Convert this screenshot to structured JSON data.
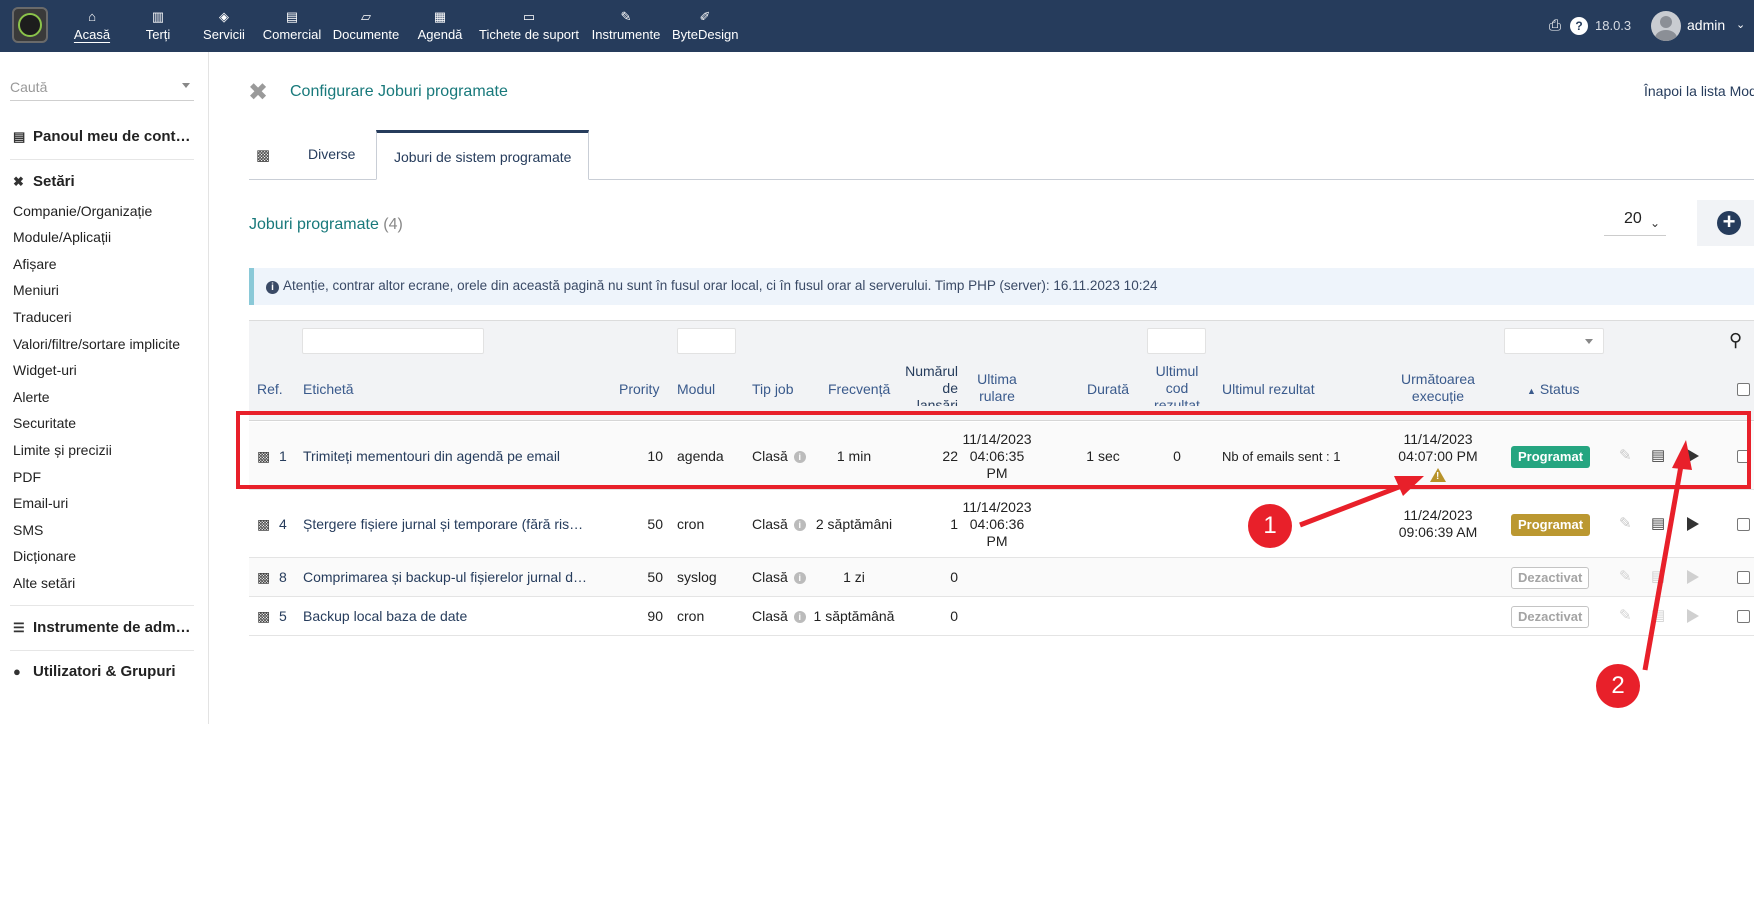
{
  "topbar": {
    "nav": [
      {
        "label": "Acasă",
        "icon": "home-icon",
        "glyph": "⌂"
      },
      {
        "label": "Terți",
        "icon": "building-icon",
        "glyph": "▥"
      },
      {
        "label": "Servicii",
        "icon": "cube-icon",
        "glyph": "◈"
      },
      {
        "label": "Comercial",
        "icon": "briefcase-icon",
        "glyph": "▤"
      },
      {
        "label": "Documente",
        "icon": "folder-icon",
        "glyph": "▱"
      },
      {
        "label": "Agendă",
        "icon": "calendar-icon",
        "glyph": "▦"
      },
      {
        "label": "Tichete de suport",
        "icon": "ticket-icon",
        "glyph": "▭"
      },
      {
        "label": "Instrumente",
        "icon": "wrench-icon",
        "glyph": "✎"
      },
      {
        "label": "ByteDesign",
        "icon": "edit-icon",
        "glyph": "✐"
      }
    ],
    "version": "18.0.3",
    "user": "admin"
  },
  "sidebar": {
    "search_placeholder": "Caută",
    "dashboard": "Panoul meu de cont…",
    "setup_heading": "Setări",
    "setup_items": [
      "Companie/Organizație",
      "Module/Aplicații",
      "Afișare",
      "Meniuri",
      "Traduceri",
      "Valori/filtre/sortare implicite",
      "Widget-uri",
      "Alerte",
      "Securitate",
      "Limite și precizii",
      "PDF",
      "Email-uri",
      "SMS",
      "Dicționare",
      "Alte setări"
    ],
    "admin_tools": "Instrumente de adm…",
    "users_groups": "Utilizatori & Grupuri"
  },
  "page": {
    "title": "Configurare Joburi programate",
    "back_link": "Înapoi la lista Mod"
  },
  "tabs": [
    {
      "label": "Diverse"
    },
    {
      "label": "Joburi de sistem programate"
    }
  ],
  "list": {
    "title": "Joburi programate",
    "count": "(4)",
    "page_size": "20",
    "notice": "Atenție, contrar altor ecrane, orele din această pagină nu sunt în fusul orar local, ci în fusul orar al serverului. Timp PHP (server): 16.11.2023 10:24"
  },
  "columns": {
    "ref": "Ref.",
    "label": "Etichetă",
    "priority": "Prority",
    "module": "Modul",
    "job_type": "Tip job",
    "frequency": "Frecvență",
    "launches": "Numărul de lansări",
    "last_run": "Ultima rulare",
    "duration": "Durată",
    "last_code": "Ultimul cod rezultat",
    "last_result": "Ultimul rezultat",
    "next_run": "Următoarea execuție",
    "status": "Status"
  },
  "rows": [
    {
      "ref": "1",
      "label": "Trimiteți mementouri din agendă pe email",
      "priority": "10",
      "module": "agenda",
      "type": "Clasă",
      "frequency": "1 min",
      "launches": "22",
      "last_run": "11/14/2023 04:06:35 PM",
      "duration": "1 sec",
      "code": "0",
      "result": "Nb of emails sent : 1",
      "next_run": "11/14/2023 04:07:00 PM",
      "status": "Programat",
      "status_color": "#25a580",
      "warning": true
    },
    {
      "ref": "4",
      "label": "Ștergere fișiere jurnal și temporare (fără ris…",
      "priority": "50",
      "module": "cron",
      "type": "Clasă",
      "frequency": "2 săptămâni",
      "launches": "1",
      "last_run": "11/14/2023 04:06:36 PM",
      "duration": "",
      "code": "",
      "result": "",
      "next_run": "11/24/2023 09:06:39 AM",
      "status": "Programat",
      "status_color": "#bb9831"
    },
    {
      "ref": "8",
      "label": "Comprimarea și backup-ul fișierelor jurnal d…",
      "priority": "50",
      "module": "syslog",
      "type": "Clasă",
      "frequency": "1 zi",
      "launches": "0",
      "last_run": "",
      "duration": "",
      "code": "",
      "result": "",
      "next_run": "",
      "status": "Dezactivat"
    },
    {
      "ref": "5",
      "label": "Backup local baza de date",
      "priority": "90",
      "module": "cron",
      "type": "Clasă",
      "frequency": "1 săptămână",
      "launches": "0",
      "last_run": "",
      "duration": "",
      "code": "",
      "result": "",
      "next_run": "",
      "status": "Dezactivat"
    }
  ],
  "annotations": {
    "callout_1": "1",
    "callout_2": "2",
    "color": "#e8202a"
  }
}
